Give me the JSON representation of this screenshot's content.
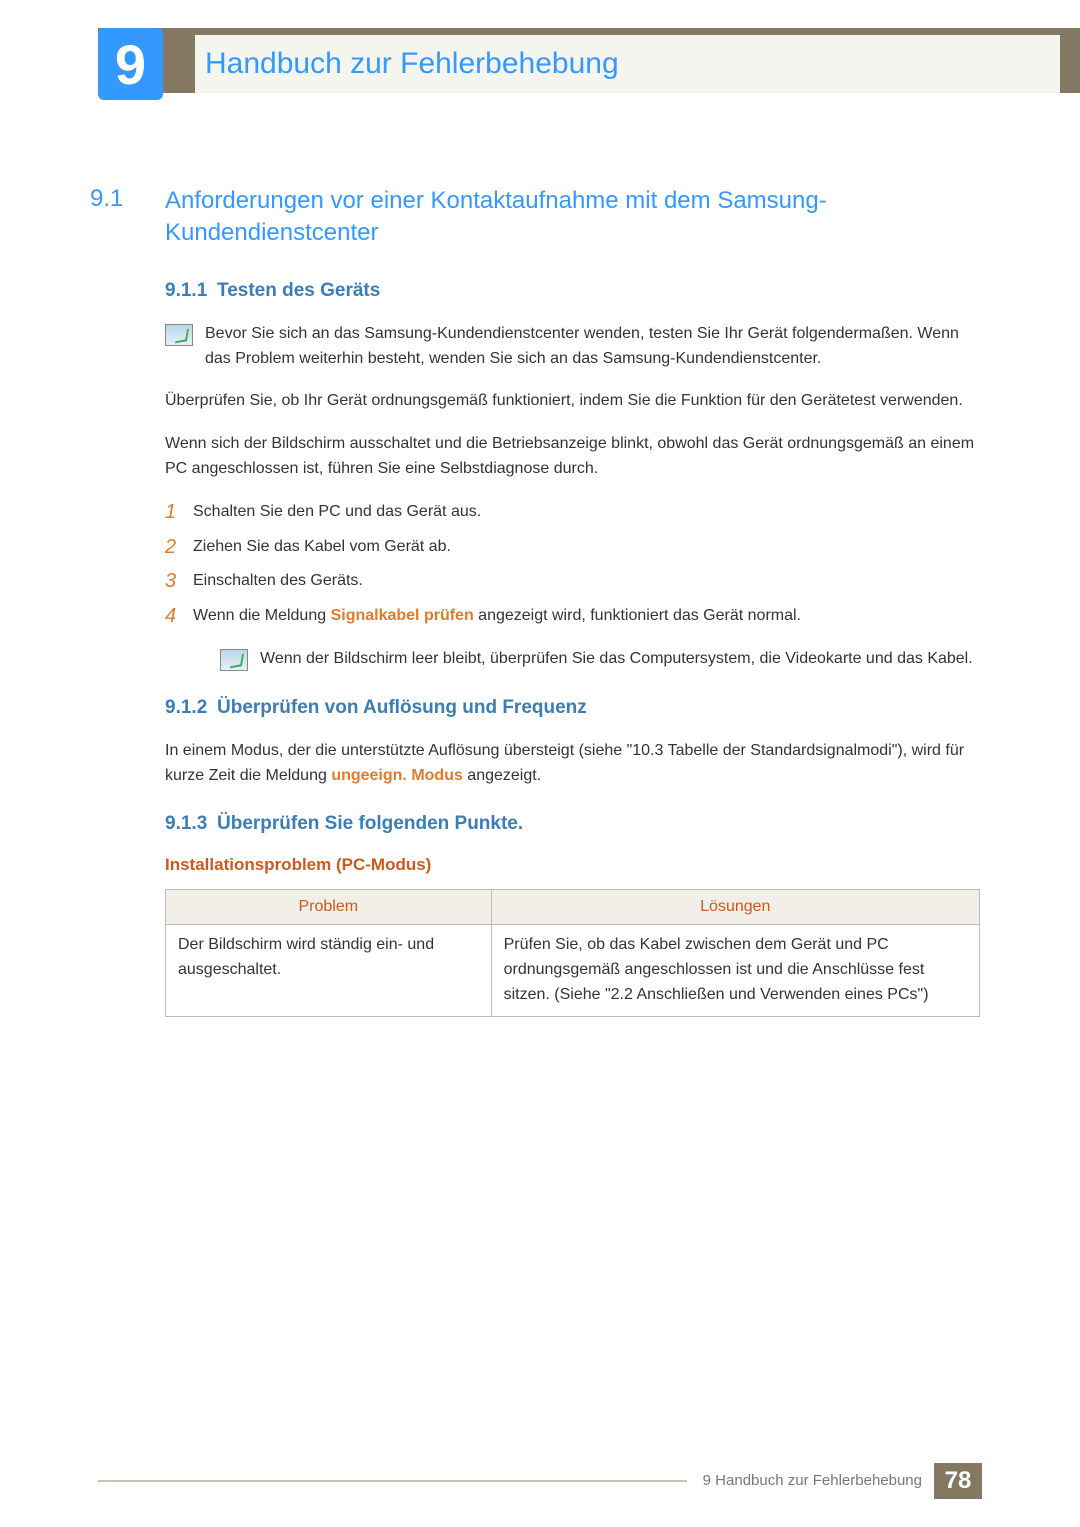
{
  "chapter": {
    "number": "9",
    "title": "Handbuch zur Fehlerbehebung"
  },
  "section": {
    "number": "9.1",
    "title": "Anforderungen vor einer Kontaktaufnahme mit dem Samsung-Kundendienstcenter"
  },
  "s911": {
    "num": "9.1.1",
    "title": "Testen des Geräts",
    "note": "Bevor Sie sich an das Samsung-Kundendienstcenter wenden, testen Sie Ihr Gerät folgendermaßen. Wenn das Problem weiterhin besteht, wenden Sie sich an das Samsung-Kundendienstcenter.",
    "p1": "Überprüfen Sie, ob Ihr Gerät ordnungsgemäß funktioniert, indem Sie die Funktion für den Gerätetest verwenden.",
    "p2": "Wenn sich der Bildschirm ausschaltet und die Betriebsanzeige blinkt, obwohl das Gerät ordnungsgemäß an einem PC angeschlossen ist, führen Sie eine Selbstdiagnose durch.",
    "steps": {
      "n1": "1",
      "t1": "Schalten Sie den PC und das Gerät aus.",
      "n2": "2",
      "t2": "Ziehen Sie das Kabel vom Gerät ab.",
      "n3": "3",
      "t3": "Einschalten des Geräts.",
      "n4": "4",
      "t4a": "Wenn die Meldung ",
      "t4b": "Signalkabel prüfen",
      "t4c": " angezeigt wird, funktioniert das Gerät normal."
    },
    "note2": "Wenn der Bildschirm leer bleibt, überprüfen Sie das Computersystem, die Videokarte und das Kabel."
  },
  "s912": {
    "num": "9.1.2",
    "title": "Überprüfen von Auflösung und Frequenz",
    "p_a": "In einem Modus, der die unterstützte Auflösung übersteigt (siehe \"10.3 Tabelle der Standardsignalmodi\"), wird für kurze Zeit die Meldung ",
    "p_b": "ungeeign. Modus",
    "p_c": " angezeigt."
  },
  "s913": {
    "num": "9.1.3",
    "title": "Überprüfen Sie folgenden Punkte.",
    "h4": "Installationsproblem (PC-Modus)",
    "th1": "Problem",
    "th2": "Lösungen",
    "td1": "Der Bildschirm wird ständig ein- und ausgeschaltet.",
    "td2": "Prüfen Sie, ob das Kabel zwischen dem Gerät und PC ordnungsgemäß angeschlossen ist und die Anschlüsse fest sitzen. (Siehe \"2.2 Anschließen und Verwenden eines PCs\")"
  },
  "footer": {
    "label": "9 Handbuch zur Fehlerbehebung",
    "page": "78"
  }
}
